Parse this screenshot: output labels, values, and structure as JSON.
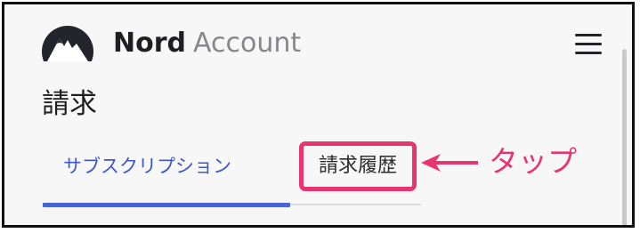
{
  "header": {
    "brand_primary": "Nord",
    "brand_secondary": "Account",
    "logo_icon": "nord-mountain-logo",
    "menu_icon": "hamburger-menu-icon"
  },
  "page": {
    "title": "請求"
  },
  "tabs": [
    {
      "label": "サブスクリプション",
      "active": true
    },
    {
      "label": "請求履歴",
      "active": false,
      "highlighted": true
    }
  ],
  "annotation": {
    "text": "タップ",
    "arrow_icon": "left-arrow-icon"
  },
  "colors": {
    "accent": "#4a63d6",
    "active_tab_text": "#3e58c7",
    "highlight": "#e8356f",
    "background": "#f7f7f8",
    "text": "#1f1f23",
    "muted": "#85878c"
  }
}
